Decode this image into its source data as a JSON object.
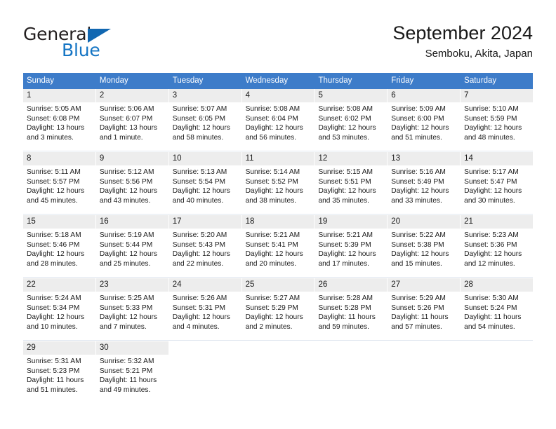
{
  "brand": {
    "name_top": "General",
    "name_bottom": "Blue",
    "color_top": "#231f20",
    "color_bottom": "#1575c4",
    "triangle_color": "#1167b1"
  },
  "header": {
    "title": "September 2024",
    "subtitle": "Semboku, Akita, Japan"
  },
  "calendar": {
    "header_color": "#3d7cc9",
    "daynum_bg": "#ededed",
    "weekdays": [
      "Sunday",
      "Monday",
      "Tuesday",
      "Wednesday",
      "Thursday",
      "Friday",
      "Saturday"
    ],
    "weeks": [
      [
        {
          "day": "1",
          "sunrise": "Sunrise: 5:05 AM",
          "sunset": "Sunset: 6:08 PM",
          "daylight_1": "Daylight: 13 hours",
          "daylight_2": "and 3 minutes."
        },
        {
          "day": "2",
          "sunrise": "Sunrise: 5:06 AM",
          "sunset": "Sunset: 6:07 PM",
          "daylight_1": "Daylight: 13 hours",
          "daylight_2": "and 1 minute."
        },
        {
          "day": "3",
          "sunrise": "Sunrise: 5:07 AM",
          "sunset": "Sunset: 6:05 PM",
          "daylight_1": "Daylight: 12 hours",
          "daylight_2": "and 58 minutes."
        },
        {
          "day": "4",
          "sunrise": "Sunrise: 5:08 AM",
          "sunset": "Sunset: 6:04 PM",
          "daylight_1": "Daylight: 12 hours",
          "daylight_2": "and 56 minutes."
        },
        {
          "day": "5",
          "sunrise": "Sunrise: 5:08 AM",
          "sunset": "Sunset: 6:02 PM",
          "daylight_1": "Daylight: 12 hours",
          "daylight_2": "and 53 minutes."
        },
        {
          "day": "6",
          "sunrise": "Sunrise: 5:09 AM",
          "sunset": "Sunset: 6:00 PM",
          "daylight_1": "Daylight: 12 hours",
          "daylight_2": "and 51 minutes."
        },
        {
          "day": "7",
          "sunrise": "Sunrise: 5:10 AM",
          "sunset": "Sunset: 5:59 PM",
          "daylight_1": "Daylight: 12 hours",
          "daylight_2": "and 48 minutes."
        }
      ],
      [
        {
          "day": "8",
          "sunrise": "Sunrise: 5:11 AM",
          "sunset": "Sunset: 5:57 PM",
          "daylight_1": "Daylight: 12 hours",
          "daylight_2": "and 45 minutes."
        },
        {
          "day": "9",
          "sunrise": "Sunrise: 5:12 AM",
          "sunset": "Sunset: 5:56 PM",
          "daylight_1": "Daylight: 12 hours",
          "daylight_2": "and 43 minutes."
        },
        {
          "day": "10",
          "sunrise": "Sunrise: 5:13 AM",
          "sunset": "Sunset: 5:54 PM",
          "daylight_1": "Daylight: 12 hours",
          "daylight_2": "and 40 minutes."
        },
        {
          "day": "11",
          "sunrise": "Sunrise: 5:14 AM",
          "sunset": "Sunset: 5:52 PM",
          "daylight_1": "Daylight: 12 hours",
          "daylight_2": "and 38 minutes."
        },
        {
          "day": "12",
          "sunrise": "Sunrise: 5:15 AM",
          "sunset": "Sunset: 5:51 PM",
          "daylight_1": "Daylight: 12 hours",
          "daylight_2": "and 35 minutes."
        },
        {
          "day": "13",
          "sunrise": "Sunrise: 5:16 AM",
          "sunset": "Sunset: 5:49 PM",
          "daylight_1": "Daylight: 12 hours",
          "daylight_2": "and 33 minutes."
        },
        {
          "day": "14",
          "sunrise": "Sunrise: 5:17 AM",
          "sunset": "Sunset: 5:47 PM",
          "daylight_1": "Daylight: 12 hours",
          "daylight_2": "and 30 minutes."
        }
      ],
      [
        {
          "day": "15",
          "sunrise": "Sunrise: 5:18 AM",
          "sunset": "Sunset: 5:46 PM",
          "daylight_1": "Daylight: 12 hours",
          "daylight_2": "and 28 minutes."
        },
        {
          "day": "16",
          "sunrise": "Sunrise: 5:19 AM",
          "sunset": "Sunset: 5:44 PM",
          "daylight_1": "Daylight: 12 hours",
          "daylight_2": "and 25 minutes."
        },
        {
          "day": "17",
          "sunrise": "Sunrise: 5:20 AM",
          "sunset": "Sunset: 5:43 PM",
          "daylight_1": "Daylight: 12 hours",
          "daylight_2": "and 22 minutes."
        },
        {
          "day": "18",
          "sunrise": "Sunrise: 5:21 AM",
          "sunset": "Sunset: 5:41 PM",
          "daylight_1": "Daylight: 12 hours",
          "daylight_2": "and 20 minutes."
        },
        {
          "day": "19",
          "sunrise": "Sunrise: 5:21 AM",
          "sunset": "Sunset: 5:39 PM",
          "daylight_1": "Daylight: 12 hours",
          "daylight_2": "and 17 minutes."
        },
        {
          "day": "20",
          "sunrise": "Sunrise: 5:22 AM",
          "sunset": "Sunset: 5:38 PM",
          "daylight_1": "Daylight: 12 hours",
          "daylight_2": "and 15 minutes."
        },
        {
          "day": "21",
          "sunrise": "Sunrise: 5:23 AM",
          "sunset": "Sunset: 5:36 PM",
          "daylight_1": "Daylight: 12 hours",
          "daylight_2": "and 12 minutes."
        }
      ],
      [
        {
          "day": "22",
          "sunrise": "Sunrise: 5:24 AM",
          "sunset": "Sunset: 5:34 PM",
          "daylight_1": "Daylight: 12 hours",
          "daylight_2": "and 10 minutes."
        },
        {
          "day": "23",
          "sunrise": "Sunrise: 5:25 AM",
          "sunset": "Sunset: 5:33 PM",
          "daylight_1": "Daylight: 12 hours",
          "daylight_2": "and 7 minutes."
        },
        {
          "day": "24",
          "sunrise": "Sunrise: 5:26 AM",
          "sunset": "Sunset: 5:31 PM",
          "daylight_1": "Daylight: 12 hours",
          "daylight_2": "and 4 minutes."
        },
        {
          "day": "25",
          "sunrise": "Sunrise: 5:27 AM",
          "sunset": "Sunset: 5:29 PM",
          "daylight_1": "Daylight: 12 hours",
          "daylight_2": "and 2 minutes."
        },
        {
          "day": "26",
          "sunrise": "Sunrise: 5:28 AM",
          "sunset": "Sunset: 5:28 PM",
          "daylight_1": "Daylight: 11 hours",
          "daylight_2": "and 59 minutes."
        },
        {
          "day": "27",
          "sunrise": "Sunrise: 5:29 AM",
          "sunset": "Sunset: 5:26 PM",
          "daylight_1": "Daylight: 11 hours",
          "daylight_2": "and 57 minutes."
        },
        {
          "day": "28",
          "sunrise": "Sunrise: 5:30 AM",
          "sunset": "Sunset: 5:24 PM",
          "daylight_1": "Daylight: 11 hours",
          "daylight_2": "and 54 minutes."
        }
      ],
      [
        {
          "day": "29",
          "sunrise": "Sunrise: 5:31 AM",
          "sunset": "Sunset: 5:23 PM",
          "daylight_1": "Daylight: 11 hours",
          "daylight_2": "and 51 minutes."
        },
        {
          "day": "30",
          "sunrise": "Sunrise: 5:32 AM",
          "sunset": "Sunset: 5:21 PM",
          "daylight_1": "Daylight: 11 hours",
          "daylight_2": "and 49 minutes."
        },
        {
          "day": "",
          "sunrise": "",
          "sunset": "",
          "daylight_1": "",
          "daylight_2": ""
        },
        {
          "day": "",
          "sunrise": "",
          "sunset": "",
          "daylight_1": "",
          "daylight_2": ""
        },
        {
          "day": "",
          "sunrise": "",
          "sunset": "",
          "daylight_1": "",
          "daylight_2": ""
        },
        {
          "day": "",
          "sunrise": "",
          "sunset": "",
          "daylight_1": "",
          "daylight_2": ""
        },
        {
          "day": "",
          "sunrise": "",
          "sunset": "",
          "daylight_1": "",
          "daylight_2": ""
        }
      ]
    ]
  }
}
